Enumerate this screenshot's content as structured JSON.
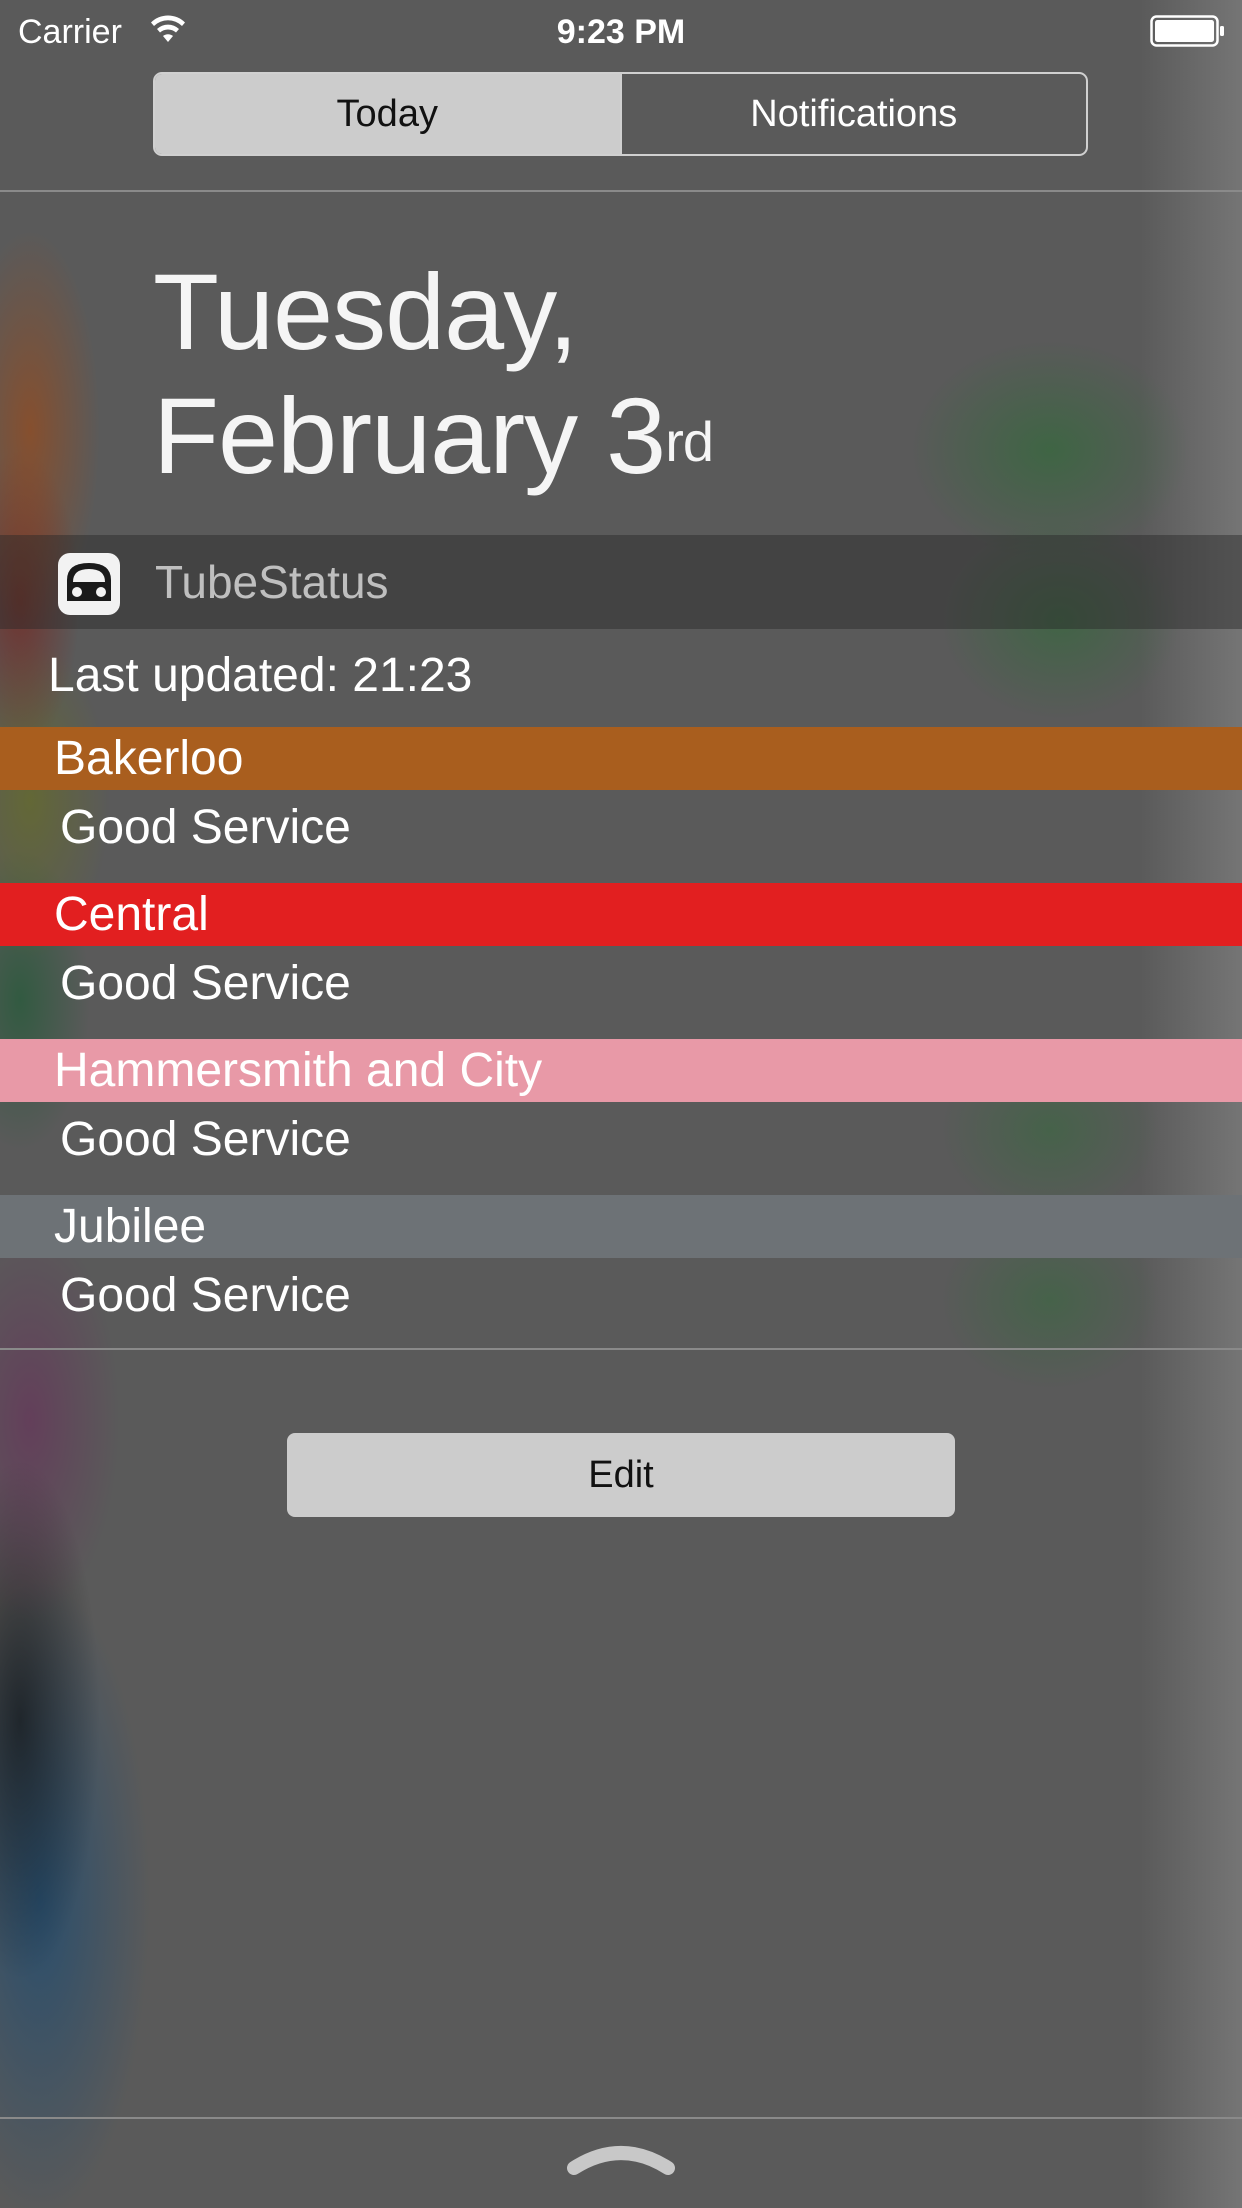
{
  "status_bar": {
    "carrier": "Carrier",
    "time": "9:23 PM",
    "wifi_icon": "wifi-icon",
    "battery_icon": "battery-icon"
  },
  "tabs": {
    "today": "Today",
    "notifications": "Notifications",
    "selected": "Today"
  },
  "date": {
    "line1": "Tuesday,",
    "line2": "February 3",
    "suffix": "rd"
  },
  "widget": {
    "app_name": "TubeStatus",
    "app_icon": "tube-train-icon",
    "last_updated": "Last updated: 21:23",
    "lines": [
      {
        "name": "Bakerloo",
        "status": "Good Service",
        "color": "#a95e1e"
      },
      {
        "name": "Central",
        "status": "Good Service",
        "color": "#e21f20"
      },
      {
        "name": "Hammersmith and City",
        "status": "Good Service",
        "color": "#e899a7"
      },
      {
        "name": "Jubilee",
        "status": "Good Service",
        "color": "#6d7276"
      }
    ]
  },
  "edit_button": "Edit",
  "footer": {
    "grabber_icon": "pull-up-handle-icon"
  }
}
